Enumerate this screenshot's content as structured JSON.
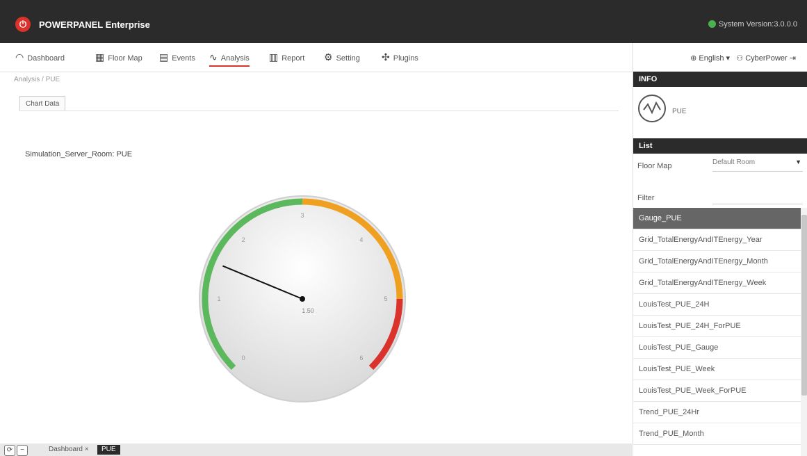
{
  "app": {
    "title": "POWERPANEL Enterprise",
    "version": "System Version:3.0.0.0"
  },
  "nav": {
    "items": [
      {
        "label": "Dashboard",
        "icon": "dashboard-icon"
      },
      {
        "label": "Floor Map",
        "icon": "floor-map-icon"
      },
      {
        "label": "Events",
        "icon": "events-icon"
      },
      {
        "label": "Analysis",
        "icon": "analysis-icon"
      },
      {
        "label": "Report",
        "icon": "report-icon"
      },
      {
        "label": "Setting",
        "icon": "setting-icon"
      },
      {
        "label": "Plugins",
        "icon": "plugins-icon"
      }
    ],
    "active": "Analysis",
    "language": "English",
    "user": "CyberPower"
  },
  "breadcrumb": "Analysis / PUE",
  "tab": "Chart Data",
  "chart_data": {
    "type": "gauge",
    "title": "Simulation_Server_Room: PUE",
    "value": 1.5,
    "value_text": "1.50",
    "min": 0,
    "max": 6,
    "ticks": [
      "0",
      "1",
      "2",
      "3",
      "4",
      "5",
      "6"
    ],
    "bands": [
      {
        "from": 0,
        "to": 3,
        "color": "#5cb85c"
      },
      {
        "from": 3,
        "to": 5,
        "color": "#f0a020"
      },
      {
        "from": 5,
        "to": 6,
        "color": "#d9332b"
      }
    ]
  },
  "bottom": {
    "tabs": [
      "Dashboard",
      "PUE"
    ]
  },
  "side": {
    "info_head": "INFO",
    "info_label": "PUE",
    "list_head": "List",
    "floor_map_label": "Floor Map",
    "floor_map_value": "Default Room",
    "filter_label": "Filter",
    "items": [
      "Gauge_PUE",
      "Grid_TotalEnergyAndITEnergy_Year",
      "Grid_TotalEnergyAndITEnergy_Month",
      "Grid_TotalEnergyAndITEnergy_Week",
      "LouisTest_PUE_24H",
      "LouisTest_PUE_24H_ForPUE",
      "LouisTest_PUE_Gauge",
      "LouisTest_PUE_Week",
      "LouisTest_PUE_Week_ForPUE",
      "Trend_PUE_24Hr",
      "Trend_PUE_Month"
    ]
  }
}
